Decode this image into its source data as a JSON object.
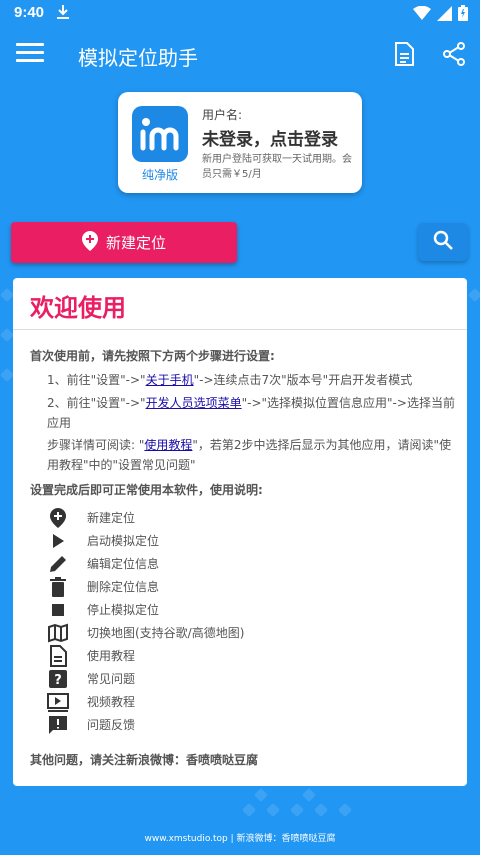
{
  "status_bar": {
    "time": "9:40"
  },
  "app_bar": {
    "title": "模拟定位助手"
  },
  "user_card": {
    "logo_label": "纯净版",
    "username_label": "用户名:",
    "login_status": "未登录，点击登录",
    "note": "新用户登陆可获取一天试用期。会员只需￥5/月"
  },
  "actions": {
    "new_location": "新建定位"
  },
  "welcome": {
    "title": "欢迎使用",
    "intro": "首次使用前，请先按照下方两个步骤进行设置:",
    "step1": {
      "prefix": "1、前往\"设置\"->\"",
      "link": "关于手机",
      "suffix": "\"->连续点击7次\"版本号\"开启开发者模式"
    },
    "step2": {
      "prefix": "2、前往\"设置\"->\"",
      "link": "开发人员选项菜单",
      "suffix": "\"->\"选择模拟位置信息应用\"->选择当前应用"
    },
    "detail": {
      "prefix": "步骤详情可阅读: \"",
      "link": "使用教程",
      "suffix": "\"，若第2步中选择后显示为其他应用，请阅读\"使用教程\"中的\"设置常见问题\""
    },
    "usage_title": "设置完成后即可正常使用本软件，使用说明:",
    "features": [
      {
        "icon": "add-location-icon",
        "label": "新建定位"
      },
      {
        "icon": "play-icon",
        "label": "启动模拟定位"
      },
      {
        "icon": "pencil-icon",
        "label": "编辑定位信息"
      },
      {
        "icon": "trash-icon",
        "label": "删除定位信息"
      },
      {
        "icon": "stop-icon",
        "label": "停止模拟定位"
      },
      {
        "icon": "map-icon",
        "label": "切换地图(支持谷歌/高德地图)"
      },
      {
        "icon": "document-icon",
        "label": "使用教程"
      },
      {
        "icon": "question-icon",
        "label": "常见问题"
      },
      {
        "icon": "video-icon",
        "label": "视频教程"
      },
      {
        "icon": "feedback-icon",
        "label": "问题反馈"
      }
    ],
    "other": "其他问题，请关注新浪微博：香喷喷哒豆腐"
  },
  "footer": "www.xmstudio.top | 新浪微博：香喷喷哒豆腐",
  "colors": {
    "primary": "#2196F3",
    "accent": "#E91E63"
  }
}
